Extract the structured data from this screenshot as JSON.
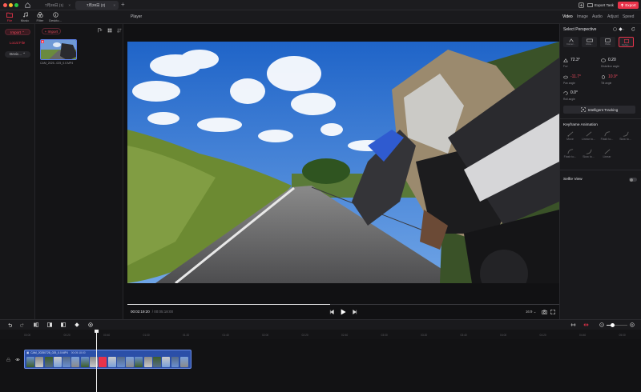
{
  "window": {
    "tabs": [
      {
        "label": "7月28日 (1)"
      },
      {
        "label": "7月28日 (2)"
      }
    ],
    "new_tab": "+",
    "export_task": "Export Task",
    "export_button": "Export"
  },
  "toolbar": {
    "left_tools": [
      "File",
      "Music",
      "Filter",
      "Deskto..."
    ],
    "player_title": "Player",
    "right_tabs": [
      "Video",
      "Image",
      "Audio",
      "Adjust",
      "Speed"
    ]
  },
  "sidebar": {
    "import": "Import",
    "local_file": "Local File",
    "device": "Devic..."
  },
  "media": {
    "import_button": "+ Import",
    "clip_name": "CAM_2025...025_0.0.MP4"
  },
  "player": {
    "time_current": "00:02:19:20",
    "time_total": "/ 00:05:18:00",
    "aspect": "16:9",
    "progress": 0.47
  },
  "inspector": {
    "select_perspective": "Select Perspective",
    "perspectives": [
      "Immer...",
      "Ultra...",
      "Wide",
      "Defau..."
    ],
    "fov_value": "72.3°",
    "fov_label": "Fov",
    "distance_value": "0.20",
    "distance_label": "Distortion angle",
    "pan_value": "-11.7°",
    "pan_label": "Pan angle",
    "tilt_value": "10.9°",
    "tilt_label": "Tilt angle",
    "roll_value": "0.0°",
    "roll_label": "Roll angle",
    "intelligent_tracking": "Intelligent Tracking",
    "keyframe_animation": "Keyframe Animation",
    "keyframes": [
      "Move",
      "Linear to...",
      "Flash to...",
      "Slow to...",
      "Flash to...",
      "Slow to...",
      "Linear"
    ],
    "selfie_view": "Selfie View"
  },
  "timeline": {
    "ticks": [
      "00:00",
      "00:20",
      "00:40",
      "01:00",
      "01:20",
      "01:40",
      "02:00",
      "02:20",
      "02:40",
      "03:00",
      "03:20",
      "03:40",
      "04:00",
      "04:20",
      "04:40",
      "05:00"
    ],
    "clip_label": "CAM_20250728_025_0.0.MP4",
    "clip_duration": "00:05:18:00"
  },
  "colors": {
    "accent": "#e8334a",
    "clip": "#2b4fa8",
    "clip_border": "#6d8fe8"
  }
}
